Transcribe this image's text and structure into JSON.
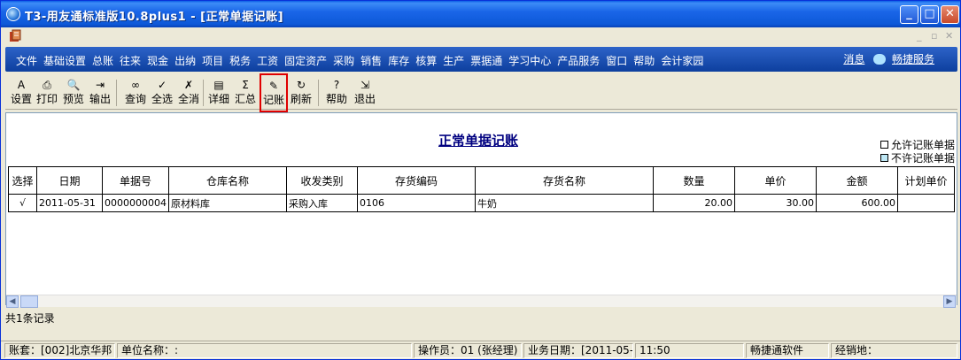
{
  "window": {
    "title": "T3-用友通标准版10.8plus1 - [正常单据记账]"
  },
  "menu": {
    "items": [
      "文件",
      "基础设置",
      "总账",
      "往来",
      "现金",
      "出纳",
      "项目",
      "税务",
      "工资",
      "固定资产",
      "采购",
      "销售",
      "库存",
      "核算",
      "生产",
      "票据通",
      "学习中心",
      "产品服务",
      "窗口",
      "帮助",
      "会计家园"
    ],
    "message_link": "消息",
    "service_link": "畅捷服务"
  },
  "toolbar": [
    {
      "label": "设置",
      "icon": "settings-icon"
    },
    {
      "label": "打印",
      "icon": "print-icon"
    },
    {
      "label": "预览",
      "icon": "preview-icon"
    },
    {
      "label": "输出",
      "icon": "export-icon"
    },
    {
      "label": "查询",
      "icon": "binoculars-icon"
    },
    {
      "label": "全选",
      "icon": "select-all-icon"
    },
    {
      "label": "全消",
      "icon": "deselect-all-icon"
    },
    {
      "label": "详细",
      "icon": "detail-icon"
    },
    {
      "label": "汇总",
      "icon": "summary-icon"
    },
    {
      "label": "记账",
      "icon": "post-icon"
    },
    {
      "label": "刷新",
      "icon": "refresh-icon"
    },
    {
      "label": "帮助",
      "icon": "help-icon"
    },
    {
      "label": "退出",
      "icon": "exit-icon"
    }
  ],
  "page": {
    "title": "正常单据记账",
    "legend_allowed": "允许记账单据",
    "legend_not_allowed": "不许记账单据",
    "legend_allowed_color": "#ffffff",
    "legend_not_allowed_color": "#bfe8f5"
  },
  "table": {
    "columns": [
      "选择",
      "日期",
      "单据号",
      "仓库名称",
      "收发类别",
      "存货编码",
      "存货名称",
      "数量",
      "单价",
      "金额",
      "计划单价"
    ],
    "rows": [
      [
        "√",
        "2011-05-31",
        "0000000004",
        "原材料库",
        "采购入库",
        "0106",
        "牛奶",
        "20.00",
        "30.00",
        "600.00",
        ""
      ]
    ]
  },
  "footer": {
    "record_count": "共1条记录"
  },
  "status": {
    "account": "账套：[002]北京华邦",
    "unit": "单位名称：:",
    "operator": "操作员：01 (张经理)",
    "business_date": "业务日期：[2011-05-",
    "time": "11:50",
    "vendor": "畅捷通软件",
    "distributor": "经销地："
  },
  "colors": {
    "titlebar": "#0d58d8",
    "menubar": "#1a4fb3",
    "highlight_border": "#e00000"
  }
}
